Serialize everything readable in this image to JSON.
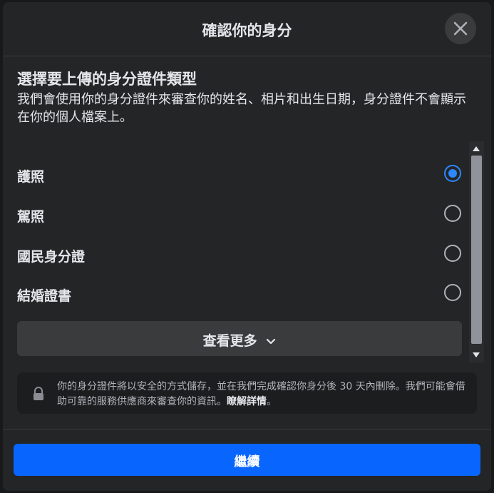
{
  "dialog": {
    "title": "確認你的身分",
    "close_icon": "close-icon"
  },
  "section": {
    "title": "選擇要上傳的身分證件類型",
    "description": "我們會使用你的身分證件來審查你的姓名、相片和出生日期，身分證件不會顯示在你的個人檔案上。"
  },
  "options": [
    {
      "label": "護照",
      "selected": true
    },
    {
      "label": "駕照",
      "selected": false
    },
    {
      "label": "國民身分證",
      "selected": false
    },
    {
      "label": "結婚證書",
      "selected": false
    }
  ],
  "see_more": {
    "label": "查看更多",
    "icon": "chevron-down-icon"
  },
  "notice": {
    "icon": "lock-icon",
    "text": "你的身分證件將以安全的方式儲存，並在我們完成確認你身分後 30 天內刪除。我們可能會借助可靠的服務供應商來審查你的資訊。",
    "link": "瞭解詳情",
    "suffix": "。"
  },
  "continue_button": {
    "label": "繼續"
  },
  "colors": {
    "accent": "#0866ff",
    "radio_selected": "#2d88ff",
    "background": "#242526"
  }
}
